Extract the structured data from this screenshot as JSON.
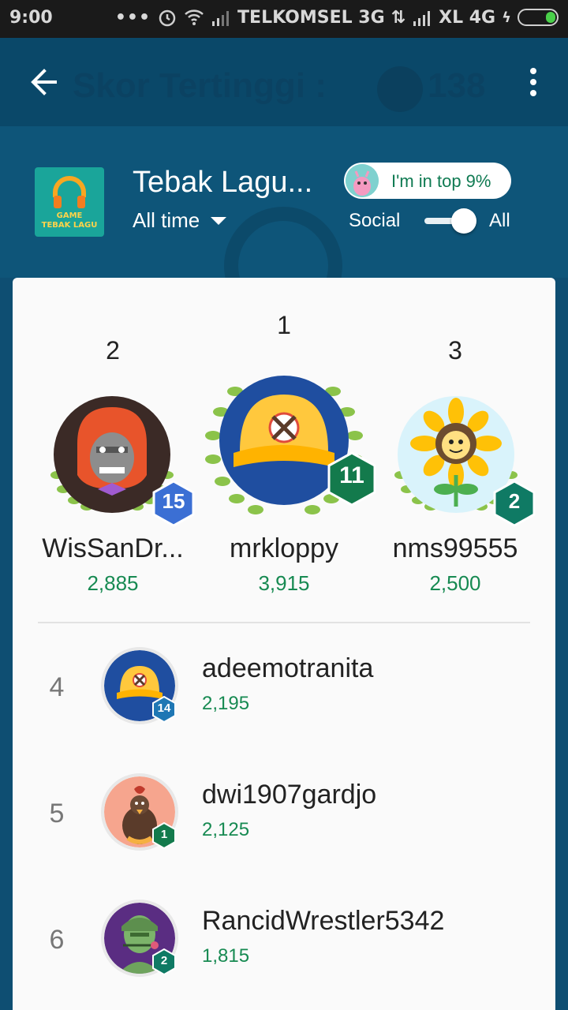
{
  "status_bar": {
    "time": "9:00",
    "carrier1": "TELKOMSEL 3G",
    "carrier2": "XL 4G"
  },
  "app_bar": {
    "title": "Skor Tertinggi :",
    "score": "138"
  },
  "header": {
    "game_title": "Tebak Lagu...",
    "game_icon_line1": "GAME",
    "game_icon_line2": "TEBAK LAGU",
    "time_filter": "All time",
    "top_pill": "I'm in top 9%",
    "toggle_social": "Social",
    "toggle_all": "All",
    "toggle_state": "All"
  },
  "podium": [
    {
      "rank": "2",
      "name": "WisSanDr...",
      "score": "2,885",
      "level": "15",
      "avatar": "orangutan-avatar",
      "level_color": "#3b6fd4"
    },
    {
      "rank": "1",
      "name": "mrkloppy",
      "score": "3,915",
      "level": "11",
      "avatar": "baseball-cap-avatar",
      "level_color": "#137a4c"
    },
    {
      "rank": "3",
      "name": "nms99555",
      "score": "2,500",
      "level": "2",
      "avatar": "sunflower-avatar",
      "level_color": "#0f7a64"
    }
  ],
  "leaderboard": [
    {
      "rank": "4",
      "name": "adeemotranita",
      "score": "2,195",
      "level": "14",
      "avatar": "baseball-cap-avatar",
      "level_color": "#1f77b4"
    },
    {
      "rank": "5",
      "name": "dwi1907gardjo",
      "score": "2,125",
      "level": "1",
      "avatar": "rooster-avatar",
      "level_color": "#137a4c"
    },
    {
      "rank": "6",
      "name": "RancidWrestler5342",
      "score": "1,815",
      "level": "2",
      "avatar": "soldier-avatar",
      "level_color": "#0f7a64"
    }
  ]
}
